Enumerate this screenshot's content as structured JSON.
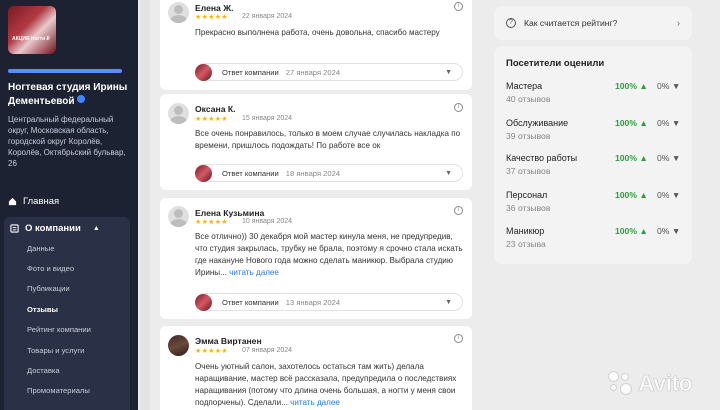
{
  "sidebar": {
    "logo_text": "АКЦИЯ Ногти ₽",
    "profile_progress": 1.0,
    "studio_name": "Ногтевая студия Ирины Дементьевой",
    "address": "Центральный федеральный округ, Московская область, городской округ Королёв, Королёв, Октябрьский бульвар, 26",
    "home_label": "Главная",
    "about_label": "О компании",
    "sub_items": [
      {
        "label": "Данные"
      },
      {
        "label": "Фото и видео"
      },
      {
        "label": "Публикации"
      },
      {
        "label": "Отзывы"
      },
      {
        "label": "Рейтинг компании"
      },
      {
        "label": "Товары и услуги"
      },
      {
        "label": "Доставка"
      },
      {
        "label": "Промоматериалы"
      }
    ]
  },
  "reviews": [
    {
      "name": "Елена Ж.",
      "stars": "★★★★★",
      "date": "22 января 2024",
      "text": "Прекрасно выполнена работа, очень довольна, спасибо мастеру",
      "reply_label": "Ответ компании",
      "reply_date": "27 января 2024"
    },
    {
      "name": "Оксана К.",
      "stars": "★★★★★",
      "date": "15 января 2024",
      "text": "Все очень понравилось, только в моем случае случилась накладка по времени, пришлось подождать! По работе все ок",
      "reply_label": "Ответ компании",
      "reply_date": "18 января 2024"
    },
    {
      "name": "Елена Кузьмина",
      "stars": "★★★★★",
      "date": "10 января 2024",
      "text": "Все отлично)) 30 декабря мой мастер кинула меня, не предупредив, что студия закрылась, трубку не брала, поэтому я срочно стала искать где накануне Нового года можно сделать маникюр. Выбрала студию Ирины...",
      "read_more": "читать далее",
      "reply_label": "Ответ компании",
      "reply_date": "13 января 2024"
    },
    {
      "name": "Эмма Виртанен",
      "stars": "★★★★★",
      "date": "07 января 2024",
      "text": "Очень уютный салон, захотелось остаться там жить) делала наращивание, мастер всё рассказала, предупредила о последствиях наращивания (потому что длина очень большая, а ногти у меня свои подпорчены). Сделали...",
      "read_more": "читать далее"
    }
  ],
  "rating_how": {
    "label": "Как считается рейтинг?"
  },
  "stats": {
    "title": "Посетители оценили",
    "criteria": [
      {
        "name": "Мастера",
        "count": "40 отзывов",
        "positive": "100%",
        "negative": "0%"
      },
      {
        "name": "Обслуживание",
        "count": "39 отзывов",
        "positive": "100%",
        "negative": "0%"
      },
      {
        "name": "Качество работы",
        "count": "37 отзывов",
        "positive": "100%",
        "negative": "0%"
      },
      {
        "name": "Персонал",
        "count": "36 отзывов",
        "positive": "100%",
        "negative": "0%"
      },
      {
        "name": "Маникюр",
        "count": "23 отзыва",
        "positive": "100%",
        "negative": "0%"
      }
    ]
  },
  "watermark": {
    "text": "Avito"
  }
}
